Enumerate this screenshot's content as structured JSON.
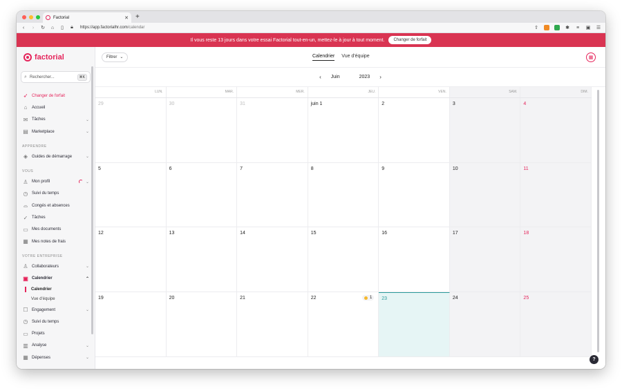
{
  "browser": {
    "tab_title": "Factorial",
    "new_tab": "+",
    "url_host": "https://app.factorialhr.com",
    "url_path": "/calendar"
  },
  "banner": {
    "text": "Il vous reste 13 jours dans votre essai Factorial tout-en-un, mettez-le à jour à tout moment.",
    "button": "Changer de forfait"
  },
  "sidebar": {
    "logo": "factorial",
    "search_placeholder": "Rechercher...",
    "search_shortcut": "⌘K",
    "top_items": [
      {
        "label": "Changer de forfait"
      },
      {
        "label": "Accueil"
      },
      {
        "label": "Tâches"
      },
      {
        "label": "Marketplace"
      }
    ],
    "section_apprendre": "APPRENDRE",
    "apprendre_items": [
      {
        "label": "Guides de démarrage"
      }
    ],
    "section_vous": "VOUS",
    "vous_items": [
      {
        "label": "Mon profil"
      },
      {
        "label": "Suivi du temps"
      },
      {
        "label": "Congés et absences"
      },
      {
        "label": "Tâches"
      },
      {
        "label": "Mes documents"
      },
      {
        "label": "Mes notes de frais"
      }
    ],
    "section_entreprise": "VOTRE ENTREPRISE",
    "entreprise_items": [
      {
        "label": "Collaborateurs"
      },
      {
        "label": "Calendrier"
      },
      {
        "label": "Calendrier"
      },
      {
        "label": "Vue d'équipe"
      },
      {
        "label": "Engagement"
      },
      {
        "label": "Suivi du temps"
      },
      {
        "label": "Projets"
      },
      {
        "label": "Analyse"
      },
      {
        "label": "Dépenses"
      }
    ]
  },
  "main": {
    "filter": "Filtrer",
    "tabs": [
      {
        "label": "Calendrier",
        "active": true
      },
      {
        "label": "Vue d'équipe",
        "active": false
      }
    ],
    "month": "Juin",
    "year": "2023",
    "weekdays": [
      "LUN.",
      "MAR.",
      "MER.",
      "JEU.",
      "VEN.",
      "SAM.",
      "DIM."
    ],
    "days": [
      {
        "label": "29",
        "other": true
      },
      {
        "label": "30",
        "other": true
      },
      {
        "label": "31",
        "other": true
      },
      {
        "label": "juin 1"
      },
      {
        "label": "2"
      },
      {
        "label": "3"
      },
      {
        "label": "4"
      },
      {
        "label": "5"
      },
      {
        "label": "6"
      },
      {
        "label": "7"
      },
      {
        "label": "8"
      },
      {
        "label": "9"
      },
      {
        "label": "10"
      },
      {
        "label": "11"
      },
      {
        "label": "12"
      },
      {
        "label": "13"
      },
      {
        "label": "14"
      },
      {
        "label": "15"
      },
      {
        "label": "16"
      },
      {
        "label": "17"
      },
      {
        "label": "18"
      },
      {
        "label": "19"
      },
      {
        "label": "20"
      },
      {
        "label": "21"
      },
      {
        "label": "22",
        "event_count": "1"
      },
      {
        "label": "23",
        "today": true
      },
      {
        "label": "24"
      },
      {
        "label": "25"
      }
    ],
    "help": "?"
  },
  "colors": {
    "brand": "#e5235a",
    "banner": "#d93452",
    "today": "#2a9a9a"
  }
}
